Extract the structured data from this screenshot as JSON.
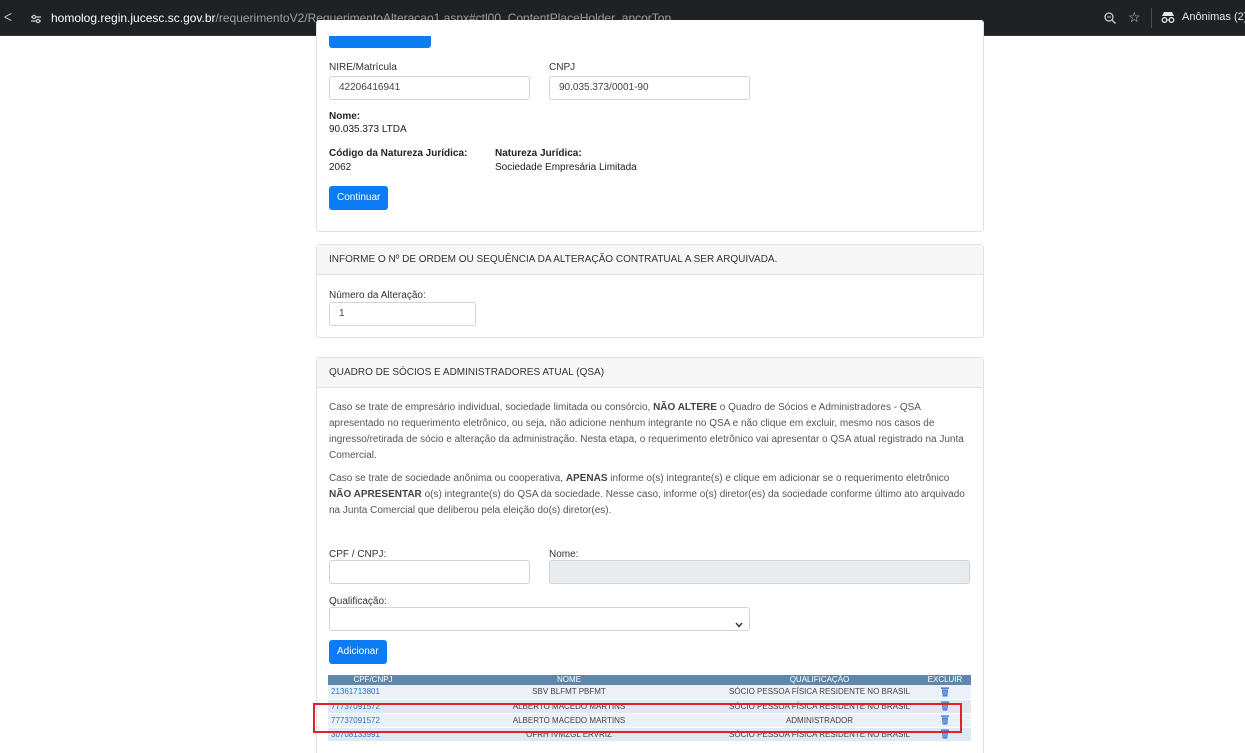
{
  "browser": {
    "url_domain": "homolog.regin.jucesc.sc.gov.br",
    "url_path": "/requerimentoV2/RequerimentoAlteracao1.aspx#ctl00_ContentPlaceHolder_ancorTop",
    "incognito_label": "Anônimas (2)",
    "icons": [
      "back-icon",
      "site-info-icon",
      "zoom-icon",
      "star-icon",
      "incognito-icon"
    ]
  },
  "empresa": {
    "nire_label": "NIRE/Matrícula",
    "nire_value": "42206416941",
    "cnpj_label": "CNPJ",
    "cnpj_value": "90.035.373/0001-90",
    "nome_label": "Nome:",
    "nome_value": "90.035.373 LTDA",
    "codigo_label": "Código da Natureza Jurídica:",
    "codigo_value": "2062",
    "natureza_label": "Natureza Jurídica:",
    "natureza_value": "Sociedade Empresária Limitada",
    "continuar_button": "Continuar"
  },
  "alteracao": {
    "header": "INFORME O Nº DE ORDEM OU SEQUÊNCIA DA ALTERAÇÃO CONTRATUAL A SER ARQUIVADA.",
    "numero_label": "Número da Alteração:",
    "numero_value": "1"
  },
  "qsa": {
    "header": "QUADRO DE SÓCIOS E ADMINISTRADORES ATUAL (QSA)",
    "para1_a": "Caso se trate de empresário individual, sociedade limitada ou consórcio, ",
    "para1_b": "NÃO ALTERE",
    "para1_c": " o Quadro de Sócios e Administradores - QSA apresentado no requerimento eletrônico, ou seja, não adicione nenhum integrante no QSA e não clique em excluir, mesmo nos casos de ingresso/retirada de sócio e alteração da administração. Nesta etapa, o requerimento eletrônico vai apresentar o QSA atual registrado na Junta Comercial.",
    "para2_a": "Caso se trate de sociedade anônima ou cooperativa, ",
    "para2_b": "APENAS",
    "para2_c": " informe o(s) integrante(s) e clique em adicionar se o requerimento eletrônico ",
    "para2_d": "NÃO APRESENTAR",
    "para2_e": " o(s) integrante(s) do QSA da sociedade. Nesse caso, informe o(s) diretor(es) da sociedade conforme último ato arquivado na Junta Comercial que deliberou pela eleição do(s) diretor(es).",
    "cpf_label": "CPF / CNPJ:",
    "cpf_value": "",
    "nome_label": "Nome:",
    "nome_value": "",
    "qualificacao_label": "Qualificação:",
    "qualificacao_value": "",
    "adicionar_button": "Adicionar",
    "table": {
      "headers": [
        "CPF/CNPJ",
        "NOME",
        "QUALIFICAÇÃO",
        "EXCLUIR"
      ],
      "rows": [
        {
          "cpf": "21361713801",
          "nome": "SBV BLFMT PBFMT",
          "qualificacao": "SÓCIO PESSOA FÍSICA RESIDENTE NO BRASIL"
        },
        {
          "cpf": "77737091572",
          "nome": "ALBERTO MACEDO MARTINS",
          "qualificacao": "SÓCIO PESSOA FÍSICA RESIDENTE NO BRASIL"
        },
        {
          "cpf": "77737091572",
          "nome": "ALBERTO MACEDO MARTINS",
          "qualificacao": "ADMINISTRADOR"
        },
        {
          "cpf": "30708133991",
          "nome": "OFRH IVMZGL ERVRIZ",
          "qualificacao": "SÓCIO PESSOA FÍSICA RESIDENTE NO BRASIL"
        }
      ]
    }
  },
  "colors": {
    "primary_button": "#0d7cf2",
    "table_header": "#5f86ab",
    "highlight_border": "#e0232b",
    "link": "#2a71c9"
  }
}
